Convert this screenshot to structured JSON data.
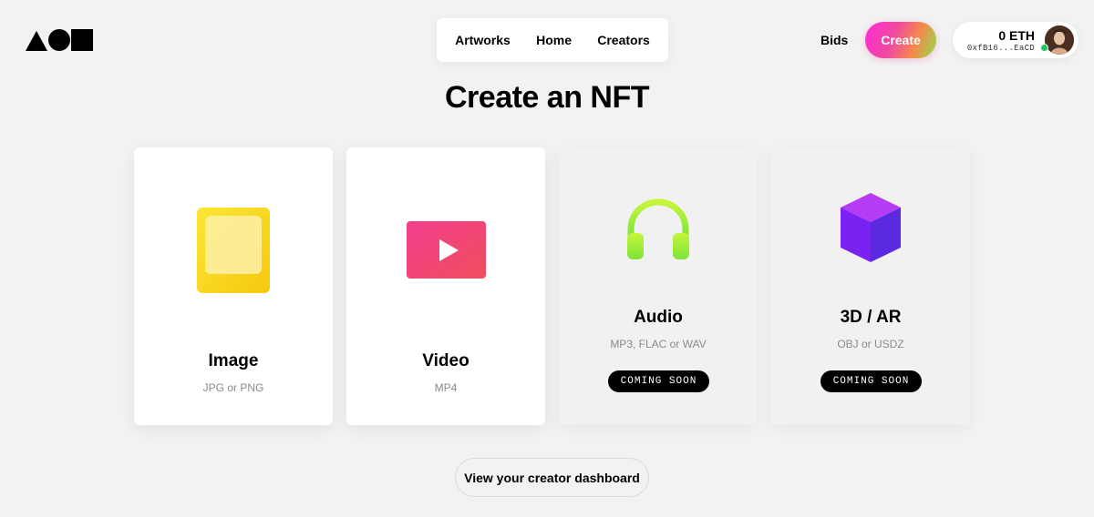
{
  "header": {
    "logo_icon": "shapes-logo-icon",
    "nav": [
      {
        "label": "Artworks"
      },
      {
        "label": "Home"
      },
      {
        "label": "Creators"
      }
    ],
    "bids_label": "Bids",
    "create_label": "Create",
    "wallet": {
      "balance": "0 ETH",
      "address": "0xfB16...EaCD",
      "status_color": "#22c55e"
    }
  },
  "main": {
    "title": "Create an NFT",
    "cards": [
      {
        "title": "Image",
        "formats": "JPG or PNG",
        "icon": "image-icon",
        "status": "available"
      },
      {
        "title": "Video",
        "formats": "MP4",
        "icon": "play-icon",
        "status": "available"
      },
      {
        "title": "Audio",
        "formats": "MP3, FLAC or WAV",
        "icon": "headphones-icon",
        "status": "coming-soon",
        "badge": "COMING SOON"
      },
      {
        "title": "3D / AR",
        "formats": "OBJ or USDZ",
        "icon": "cube-icon",
        "status": "coming-soon",
        "badge": "COMING SOON"
      }
    ],
    "dashboard_label": "View your creator dashboard"
  },
  "colors": {
    "create_gradient": [
      "#ff2bd6",
      "#f58a4a",
      "#8ae24c"
    ],
    "image_icon": "#f9d816",
    "video_icon": "#f0457a",
    "audio_icon": "#a4f23a",
    "cube_icon": "#6b2cf0"
  }
}
